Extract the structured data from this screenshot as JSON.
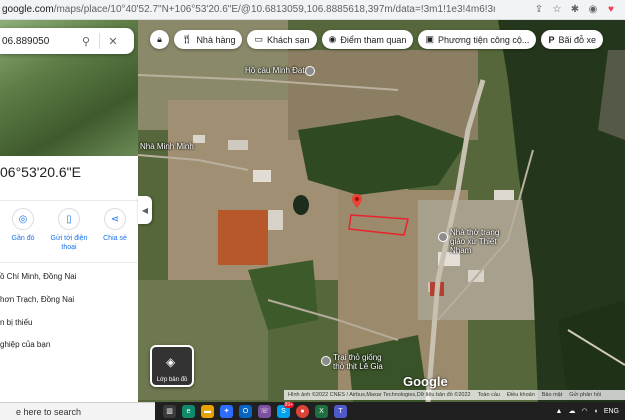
{
  "browser": {
    "url_host": "google.com",
    "url_path": "/maps/place/10°40'52.7\"N+106°53'20.6\"E/@10.6813059,106.8885618,397m/data=!3m1!1e3!4m6!3m5!1s0x0:0x...",
    "icons": [
      "share-icon",
      "star-icon",
      "extensions-icon",
      "profile-icon",
      "pocket-icon"
    ]
  },
  "search": {
    "value": "06.889050",
    "search_icon": "magnifier",
    "close_icon": "x"
  },
  "place": {
    "coordinates": "06°53'20.6\"E"
  },
  "actions": [
    {
      "label": "Gần đó",
      "icon": "nearby"
    },
    {
      "label": "Gửi tới điện thoại",
      "icon": "phone"
    },
    {
      "label": "Chia sẻ",
      "icon": "share"
    }
  ],
  "info_rows": [
    "ồ Chí Minh, Đồng Nai",
    "hơn Trạch, Đồng Nai",
    "n bị thiếu",
    "ghiệp của bạn"
  ],
  "chips": [
    {
      "label": "",
      "icon": "lock"
    },
    {
      "label": "Nhà hàng",
      "icon": "restaurant"
    },
    {
      "label": "Khách sạn",
      "icon": "hotel"
    },
    {
      "label": "Điểm tham quan",
      "icon": "camera"
    },
    {
      "label": "Phương tiện công cộ...",
      "icon": "transit"
    },
    {
      "label": "Bãi đỗ xe",
      "icon": "parking"
    }
  ],
  "map_labels": {
    "ho_ca": "Hồ cáu Minh Đạt",
    "minh_minh": "Nhà Minh Minh",
    "trang_giao": "Nhà thờ trang giáo xứ Thiết Nham",
    "trai_tho": "Trại thỏ giống thỏ thịt Lê Gia"
  },
  "layers": {
    "label": "Lớp bản đồ"
  },
  "google_logo": "Google",
  "attribution": {
    "imagery": "Hình ảnh ©2022 CNES / Airbus,Maxar Technologies,Dữ liệu bản đồ ©2022",
    "links": [
      "Toàn cầu",
      "Điều khoản",
      "Bảo mật",
      "Gửi phản hồi"
    ]
  },
  "taskbar": {
    "search_placeholder": "e here to search",
    "apps": [
      {
        "name": "task-view-icon",
        "color": "#3a3a3a"
      },
      {
        "name": "edge-icon",
        "color": "#0f8b6c"
      },
      {
        "name": "explorer-icon",
        "color": "#e8a200"
      },
      {
        "name": "messenger-icon",
        "color": "#2b6dff"
      },
      {
        "name": "outlook-icon",
        "color": "#0a64c2"
      },
      {
        "name": "viber-icon",
        "color": "#7b519d"
      },
      {
        "name": "skype-icon",
        "color": "#00a2ed"
      },
      {
        "name": "chrome-icon",
        "color": "#db4437"
      },
      {
        "name": "excel-icon",
        "color": "#1d6f42"
      },
      {
        "name": "teams-icon",
        "color": "#5059c9"
      }
    ],
    "badge": "99+",
    "tray_lang": "ENG"
  },
  "colors": {
    "accent": "#1a73e8",
    "parcel_outline": "#e8232b"
  }
}
